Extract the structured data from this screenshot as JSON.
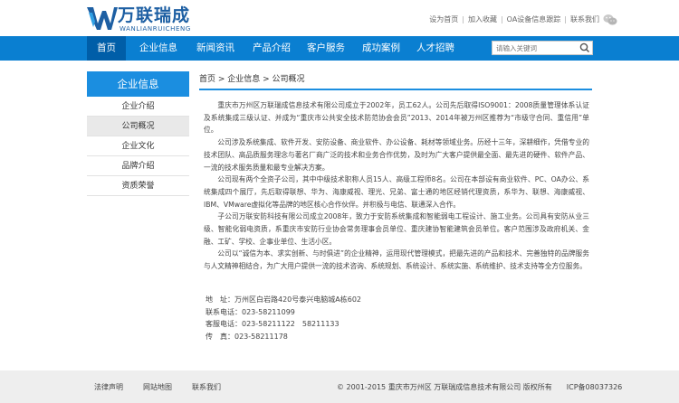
{
  "brand": {
    "name_cn": "万联瑞成",
    "name_en": "WANLIANRUICHENG"
  },
  "toplinks": [
    "设为首页",
    "加入收藏",
    "OA设备信息跟踪",
    "联系我们"
  ],
  "nav": {
    "items": [
      "首页",
      "企业信息",
      "新闻资讯",
      "产品介绍",
      "客户服务",
      "成功案例",
      "人才招聘"
    ],
    "search_placeholder": "请输入关键词"
  },
  "sidebar": {
    "title": "企业信息",
    "items": [
      "企业介绍",
      "公司概况",
      "企业文化",
      "品牌介绍",
      "资质荣誉"
    ]
  },
  "breadcrumb": "首页 > 企业信息 > 公司概况",
  "article": {
    "paragraphs": [
      "重庆市万州区万联瑞成信息技术有限公司成立于2002年，员工62人。公司先后取得ISO9001：2008质量管理体系认证及系统集成三级认证、并成为“重庆市公共安全技术防范协会会员”2013、2014年被万州区推荐为“市级守合同、重信用”单位。",
      "公司涉及系统集成、软件开发、安防设备、商业软件、办公设备、耗材等领域业务。历经十三年，深耕细作，凭借专业的技术团队、高品质服务理念与著名厂商广泛的技术和业务合作优势，及时为广大客户提供最全面、最先进的硬件、软件产品、一流的技术服务质量和最专业解决方案。",
      "公司现有两个全资子公司，其中中级技术职称人员15人、高级工程师8名。公司在本部设有商业软件、PC、OA办公、系统集成四个展厅，先后取得联想、华为、海康威视、理光、兄弟、富士通的地区经销代理资质，系华为、联想、海康威视、IBM、VMware虚拟化等品牌的地区核心合作伙伴。并积极与电信、联通深入合作。",
      "子公司万联安防科技有限公司成立2008年，致力于安防系统集成和智能弱电工程设计、施工业务。公司具有安防从业三级、智能化弱电资质，系重庆市安防行业协会常务理事会员单位、重庆建协智能建筑会员单位。客户范围涉及政府机关、金融、工矿、学校、企事业单位、生活小区。",
      "公司以“诚信为本、求实创新、与时俱进”的企业精神，运用现代管理模式，把最先进的产品和技术、完善独特的品牌服务与人文精神相结合，为广大用户提供一流的技术咨询、系统规划、系统设计、系统实施、系统维护、技术支持等全方位服务。"
    ]
  },
  "contact": [
    "地　址：万州区白岩路420号泰兴电脑城A栋602",
    "联系电话：023-58211099",
    "客服电话：023-58211122　58211133",
    "传　真：023-58211178"
  ],
  "footer": {
    "links": [
      "法律声明",
      "网站地图",
      "联系我们"
    ],
    "copyright": "© 2001-2015 重庆市万州区 万联瑞成信息技术有限公司 版权所有　　ICP备08037326"
  },
  "colors": {
    "nav_bg": "#0a7fd1",
    "nav_active": "#005ea8",
    "accent": "#1b8ee0",
    "brand": "#1d5fa3"
  }
}
